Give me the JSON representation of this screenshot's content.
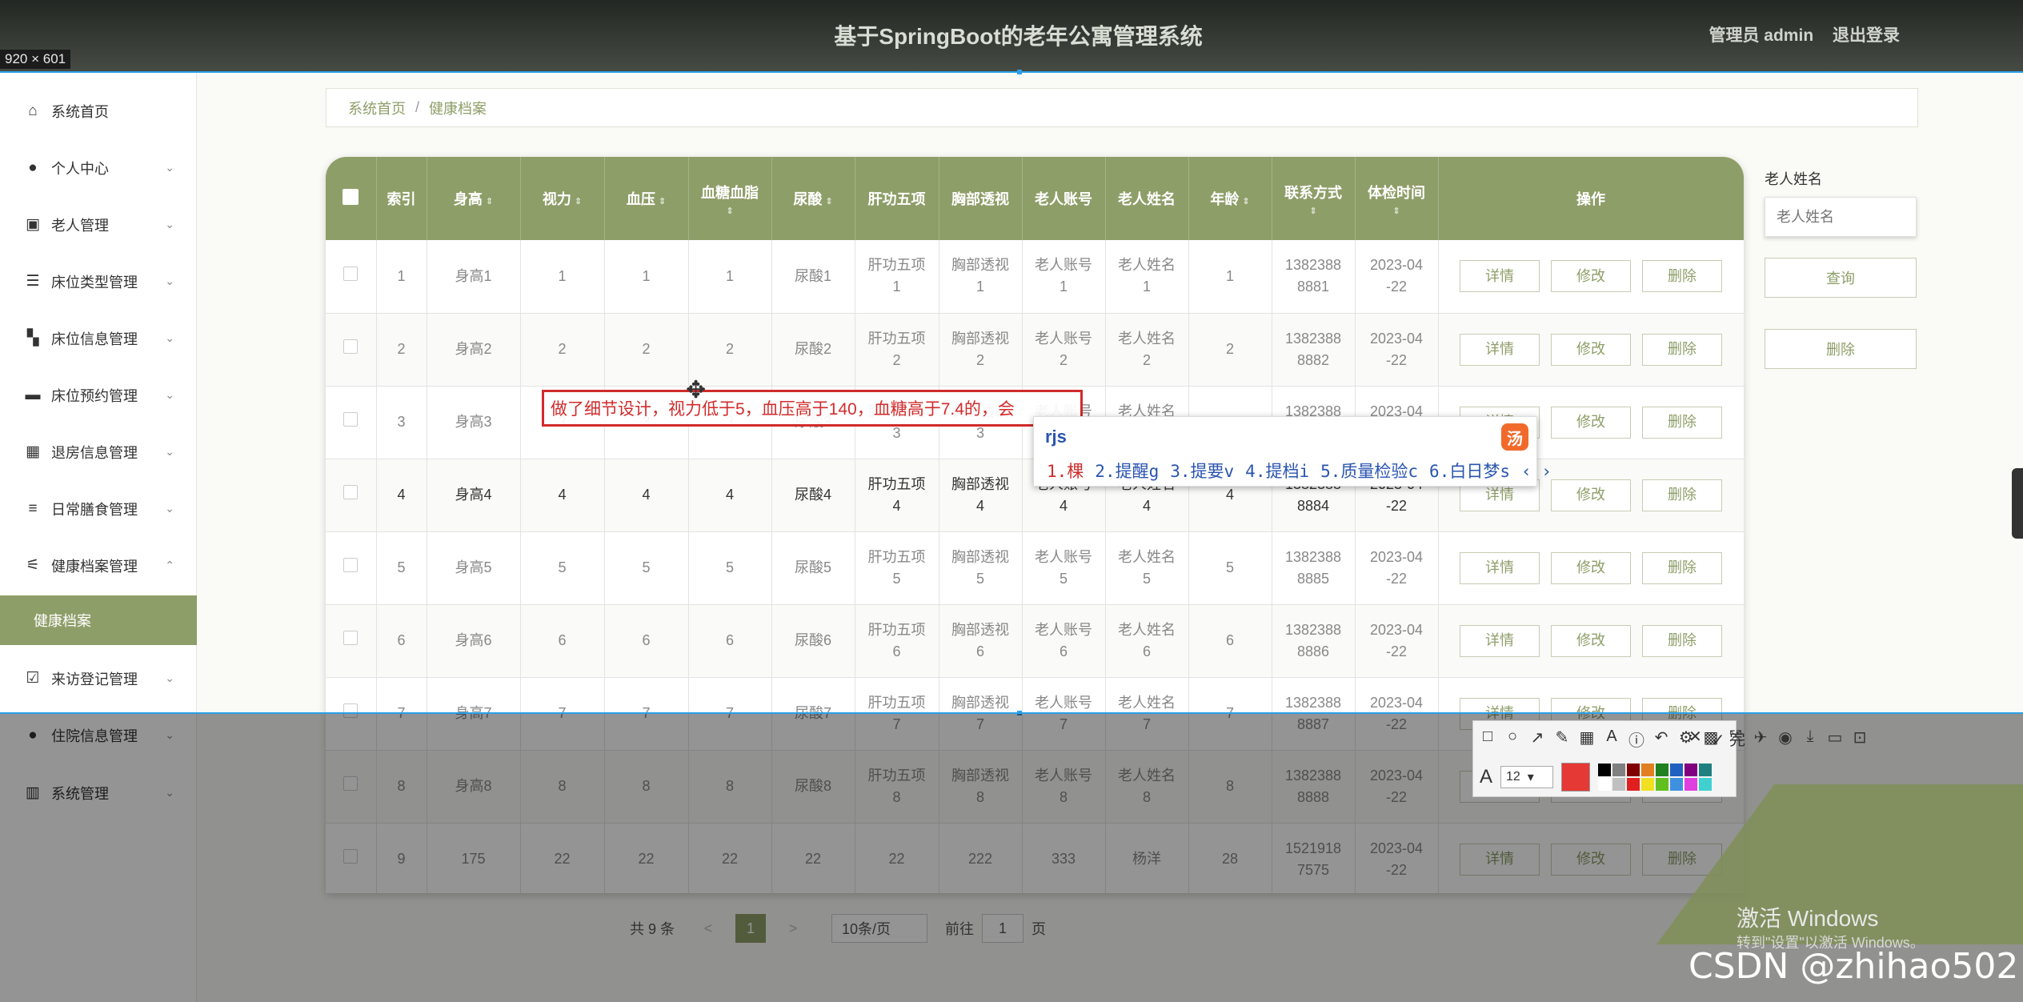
{
  "header": {
    "title": "基于SpringBoot的老年公寓管理系统",
    "user": "管理员 admin",
    "logout": "退出登录"
  },
  "badge": {
    "dimensions": "920 × 601"
  },
  "sidebar": {
    "items": [
      {
        "label": "系统首页",
        "icon": "home-icon",
        "glyph": "⌂",
        "chevron": ""
      },
      {
        "label": "个人中心",
        "icon": "user-icon",
        "glyph": "●",
        "chevron": "⌄"
      },
      {
        "label": "老人管理",
        "icon": "clipboard-icon",
        "glyph": "▣",
        "chevron": "⌄"
      },
      {
        "label": "床位类型管理",
        "icon": "list-icon",
        "glyph": "☰",
        "chevron": "⌄"
      },
      {
        "label": "床位信息管理",
        "icon": "ticket-icon",
        "glyph": "▚",
        "chevron": "⌄"
      },
      {
        "label": "床位预约管理",
        "icon": "monitor-icon",
        "glyph": "▬",
        "chevron": "⌄"
      },
      {
        "label": "退房信息管理",
        "icon": "grid-icon",
        "glyph": "▦",
        "chevron": "⌄"
      },
      {
        "label": "日常膳食管理",
        "icon": "menu-icon",
        "glyph": "≡",
        "chevron": "⌄"
      },
      {
        "label": "健康档案管理",
        "icon": "sliders-icon",
        "glyph": "⚟",
        "chevron": "⌃"
      },
      {
        "label": "来访登记管理",
        "icon": "checklist-icon",
        "glyph": "☑",
        "chevron": "⌄"
      },
      {
        "label": "住院信息管理",
        "icon": "person-icon",
        "glyph": "●",
        "chevron": "⌄"
      },
      {
        "label": "系统管理",
        "icon": "chart-icon",
        "glyph": "▥",
        "chevron": "⌄"
      }
    ],
    "active_sub": "健康档案"
  },
  "breadcrumb": {
    "home": "系统首页",
    "current": "健康档案"
  },
  "table": {
    "headers": [
      "索引",
      "身高",
      "视力",
      "血压",
      "血糖血脂",
      "尿酸",
      "肝功五项",
      "胸部透视",
      "老人账号",
      "老人姓名",
      "年龄",
      "联系方式",
      "体检时间",
      "操作"
    ],
    "rows": [
      [
        "1",
        "身高1",
        "1",
        "1",
        "1",
        "尿酸1",
        "肝功五项\n1",
        "胸部透视\n1",
        "老人账号\n1",
        "老人姓名\n1",
        "1",
        "1382388\n8881",
        "2023-04\n-22"
      ],
      [
        "2",
        "身高2",
        "2",
        "2",
        "2",
        "尿酸2",
        "肝功五项\n2",
        "胸部透视\n2",
        "老人账号\n2",
        "老人姓名\n2",
        "2",
        "1382388\n8882",
        "2023-04\n-22"
      ],
      [
        "3",
        "身高3",
        "3",
        "3",
        "3",
        "尿酸3",
        "肝功五项\n3",
        "胸部透视\n3",
        "老人账号\n3",
        "老人姓名\n3",
        "3",
        "1382388\n8883",
        "2023-04\n-22"
      ],
      [
        "4",
        "身高4",
        "4",
        "4",
        "4",
        "尿酸4",
        "肝功五项\n4",
        "胸部透视\n4",
        "老人账号\n4",
        "老人姓名\n4",
        "4",
        "1382388\n8884",
        "2023-04\n-22"
      ],
      [
        "5",
        "身高5",
        "5",
        "5",
        "5",
        "尿酸5",
        "肝功五项\n5",
        "胸部透视\n5",
        "老人账号\n5",
        "老人姓名\n5",
        "5",
        "1382388\n8885",
        "2023-04\n-22"
      ],
      [
        "6",
        "身高6",
        "6",
        "6",
        "6",
        "尿酸6",
        "肝功五项\n6",
        "胸部透视\n6",
        "老人账号\n6",
        "老人姓名\n6",
        "6",
        "1382388\n8886",
        "2023-04\n-22"
      ],
      [
        "7",
        "身高7",
        "7",
        "7",
        "7",
        "尿酸7",
        "肝功五项\n7",
        "胸部透视\n7",
        "老人账号\n7",
        "老人姓名\n7",
        "7",
        "1382388\n8887",
        "2023-04\n-22"
      ],
      [
        "8",
        "身高8",
        "8",
        "8",
        "8",
        "尿酸8",
        "肝功五项\n8",
        "胸部透视\n8",
        "老人账号\n8",
        "老人姓名\n8",
        "8",
        "1382388\n8888",
        "2023-04\n-22"
      ],
      [
        "9",
        "175",
        "22",
        "22",
        "22",
        "22",
        "22",
        "222",
        "333",
        "杨洋",
        "28",
        "1521918\n7575",
        "2023-04\n-22"
      ]
    ],
    "actions": {
      "detail": "详情",
      "edit": "修改",
      "delete": "删除"
    }
  },
  "search": {
    "label": "老人姓名",
    "placeholder": "老人姓名",
    "query": "查询",
    "delete": "删除"
  },
  "pagination": {
    "total": "共 9 条",
    "prev": "<",
    "page": "1",
    "next": ">",
    "per_page": "10条/页",
    "goto": "前往",
    "goto_value": "1",
    "page_unit": "页"
  },
  "annotation": {
    "text": "做了细节设计，视力低于5，血压高于140，血糖高于7.4的，会"
  },
  "ime": {
    "input": "rjs",
    "logo": "汤",
    "candidates": [
      "1.棵",
      "2.提醒g",
      "3.提要v",
      "4.提档i",
      "5.质量检验c",
      "6.白日梦s"
    ],
    "nav": "‹ ›"
  },
  "screenshot_toolbar": {
    "tools": [
      "□",
      "○",
      "↗",
      "✎",
      "▦",
      "A",
      "ⓘ",
      "↶",
      "⚙",
      "▩",
      "⤧",
      "✈",
      "◉",
      "⤓",
      "▭",
      "⊡"
    ],
    "close": "✕",
    "done": "✓ 完",
    "font_icon": "A",
    "size": "12",
    "current_color": "#e53935",
    "palette": [
      "#000000",
      "#808080",
      "#800000",
      "#e08020",
      "#208020",
      "#2060c0",
      "#800080",
      "#208080",
      "#ffffff",
      "#c0c0c0",
      "#e02020",
      "#f0e020",
      "#60c020",
      "#4090e0",
      "#e040e0",
      "#40d0d0"
    ]
  },
  "watermark": {
    "win_title": "激活 Windows",
    "win_sub": "转到\"设置\"以激活 Windows。",
    "csdn": "CSDN @zhihao502"
  }
}
